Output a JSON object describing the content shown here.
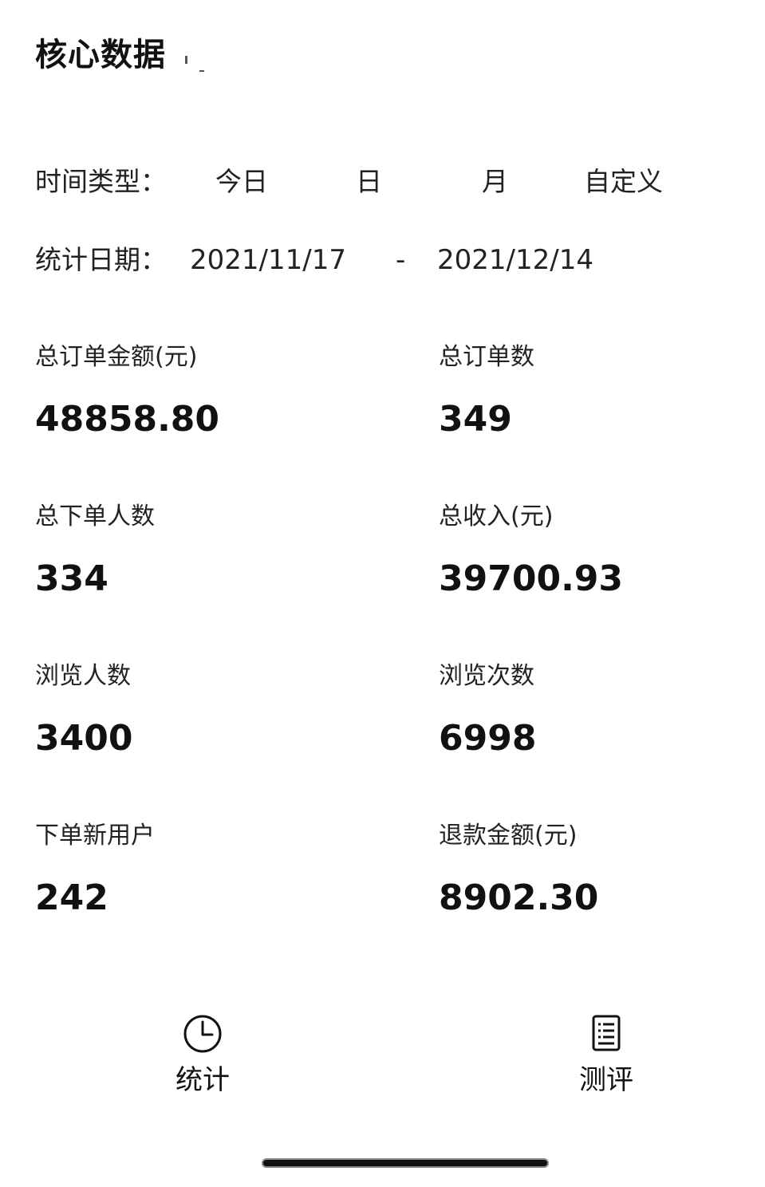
{
  "header": {
    "title": "核心数据"
  },
  "filters": {
    "time_type_label": "时间类型：",
    "time_options": [
      "今日",
      "日",
      "月",
      "自定义"
    ],
    "date_label": "统计日期：",
    "start_date": "2021/11/17",
    "separator": "-",
    "end_date": "2021/12/14"
  },
  "stats": [
    {
      "label": "总订单金额(元)",
      "value": "48858.80"
    },
    {
      "label": "总订单数",
      "value": "349"
    },
    {
      "label": "总下单人数",
      "value": "334"
    },
    {
      "label": "总收入(元)",
      "value": "39700.93"
    },
    {
      "label": "浏览人数",
      "value": "3400"
    },
    {
      "label": "浏览次数",
      "value": "6998"
    },
    {
      "label": "下单新用户",
      "value": "242"
    },
    {
      "label": "退款金额(元)",
      "value": "8902.30"
    }
  ],
  "tabbar": {
    "tabs": [
      {
        "label": "统计",
        "icon": "clock-icon"
      },
      {
        "label": "测评",
        "icon": "document-list-icon"
      }
    ]
  }
}
